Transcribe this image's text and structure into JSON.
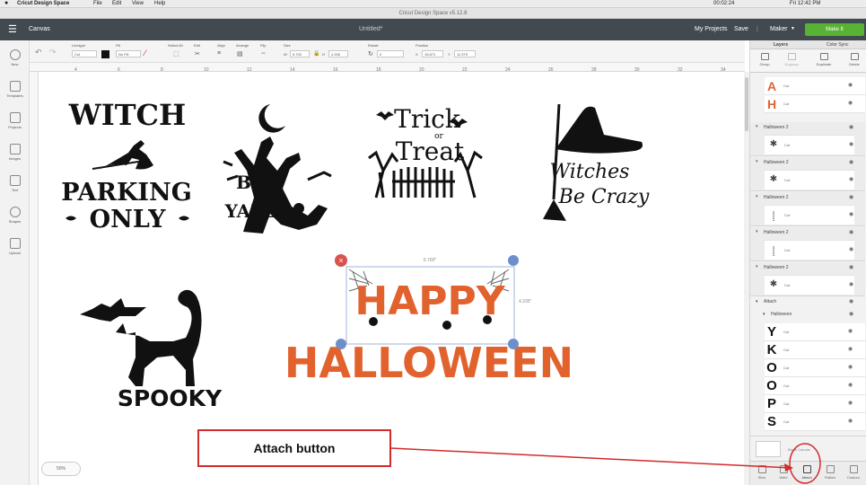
{
  "mac_menu": {
    "app": "Cricut Design Space",
    "items": [
      "File",
      "Edit",
      "View",
      "Help"
    ],
    "status": "00:02:24",
    "clock": "Fri 12:42 PM"
  },
  "window": {
    "title": "Cricut Design Space  v5.12.8"
  },
  "header": {
    "menu_icon": "hamburger-icon",
    "section": "Canvas",
    "doc_title": "Untitled*",
    "my_projects": "My Projects",
    "save": "Save",
    "machine": "Maker",
    "make_it": "Make It",
    "brand_color": "#58b233"
  },
  "toolbar": {
    "undo": "undo-icon",
    "redo": "redo-icon",
    "linetype_label": "Linetype",
    "linetype_value": "Cut",
    "fill_label": "Fill",
    "fill_value": "No Fill",
    "select_all_label": "Select All",
    "edit_label": "Edit",
    "align_label": "Align",
    "arrange_label": "Arrange",
    "flip_label": "Flip",
    "size_label": "Size",
    "w_label": "W",
    "w_value": "6.700",
    "h_label": "H",
    "h_value": "4.335",
    "rotate_label": "Rotate",
    "rotate_value": "0",
    "position_label": "Position",
    "x_label": "X",
    "x_value": "15.871",
    "y_label": "Y",
    "y_value": "11.375"
  },
  "left_rail": [
    {
      "label": "New",
      "icon": "plus-icon"
    },
    {
      "label": "Templates",
      "icon": "shirt-icon"
    },
    {
      "label": "Projects",
      "icon": "projects-icon"
    },
    {
      "label": "Images",
      "icon": "image-icon"
    },
    {
      "label": "Text",
      "icon": "text-icon"
    },
    {
      "label": "Shapes",
      "icon": "shapes-icon"
    },
    {
      "label": "Upload",
      "icon": "upload-icon"
    }
  ],
  "ruler_top": [
    "4",
    "6",
    "8",
    "10",
    "12",
    "14",
    "16",
    "18",
    "20",
    "22",
    "24",
    "26",
    "28",
    "30",
    "32",
    "34",
    "36"
  ],
  "canvas": {
    "designs": [
      {
        "lines": [
          "WITCH",
          "PARKING",
          "ONLY"
        ]
      },
      {
        "lines": [
          "BOO",
          "YALL"
        ]
      },
      {
        "lines": [
          "Trick",
          "or",
          "Treat"
        ]
      },
      {
        "lines": [
          "Witches",
          "Be Crazy"
        ]
      },
      {
        "lines": [
          "SPOOKY"
        ]
      },
      {
        "lines": [
          "HAPPY",
          "HALLOWEEN"
        ]
      }
    ],
    "sel_width": "6.700\"",
    "sel_height": "4.335\"",
    "accent": "#e2622e",
    "zoom": "50%"
  },
  "panel": {
    "tabs": [
      "Layers",
      "Color Sync"
    ],
    "tools": [
      "Group",
      "Ungroup",
      "Duplicate",
      "Delete"
    ],
    "top_items": [
      {
        "op": "Cut"
      },
      {
        "op": "Cut"
      }
    ],
    "groups": [
      {
        "name": "Halloween 2",
        "op": "Cut"
      },
      {
        "name": "Halloween 2",
        "op": "Cut"
      },
      {
        "name": "Halloween 2",
        "op": "Cut"
      },
      {
        "name": "Halloween 2",
        "op": "Cut"
      },
      {
        "name": "Halloween 2",
        "op": "Cut"
      }
    ],
    "attach_label": "Attach",
    "halloween_label": "Halloween",
    "letters": [
      {
        "glyph": "Y",
        "op": "Cut"
      },
      {
        "glyph": "K",
        "op": "Cut"
      },
      {
        "glyph": "O",
        "op": "Cut"
      },
      {
        "glyph": "O",
        "op": "Cut"
      },
      {
        "glyph": "P",
        "op": "Cut"
      },
      {
        "glyph": "S",
        "op": "Cut"
      }
    ],
    "blank_canvas": "Blank Canvas",
    "bottom_tools": [
      "Slice",
      "Weld",
      "Attach",
      "Flatten",
      "Contour"
    ]
  },
  "annotation": {
    "label": "Attach button",
    "color": "#d12b2b"
  }
}
